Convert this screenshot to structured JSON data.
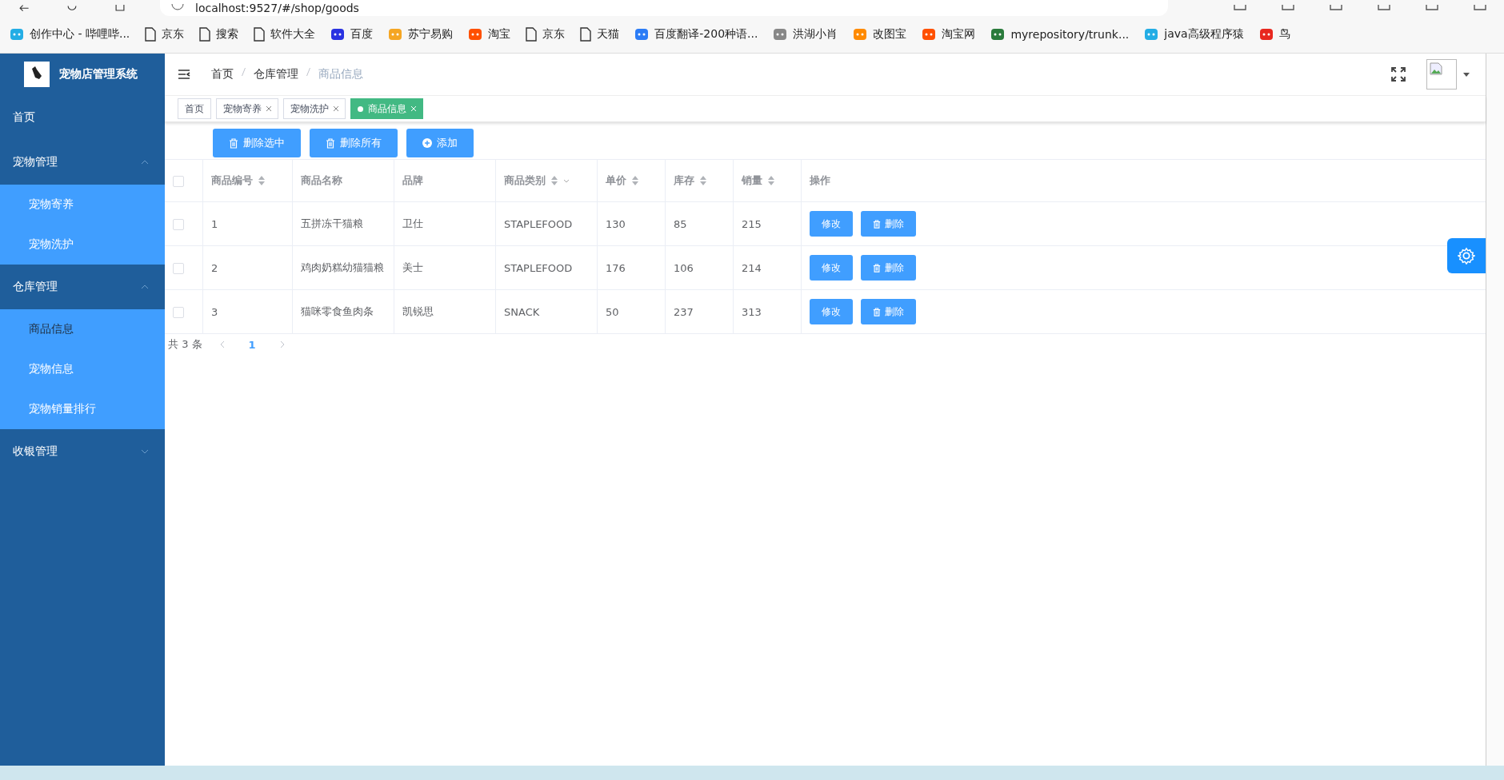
{
  "browser": {
    "address": "localhost:9527/#/shop/goods",
    "bookmarks": [
      {
        "label": "创作中心 - 哔哩哔...",
        "kind": "tv"
      },
      {
        "label": "京东",
        "kind": "page"
      },
      {
        "label": "搜索",
        "kind": "page"
      },
      {
        "label": "软件大全",
        "kind": "page"
      },
      {
        "label": "百度",
        "kind": "paw"
      },
      {
        "label": "苏宁易购",
        "kind": "lion"
      },
      {
        "label": "淘宝",
        "kind": "tao"
      },
      {
        "label": "京东",
        "kind": "page"
      },
      {
        "label": "天猫",
        "kind": "page"
      },
      {
        "label": "百度翻译-200种语...",
        "kind": "translate"
      },
      {
        "label": "洪湖小肖",
        "kind": "bird"
      },
      {
        "label": "改图宝",
        "kind": "square"
      },
      {
        "label": "淘宝网",
        "kind": "tao2"
      },
      {
        "label": "myrepository/trunk...",
        "kind": "circle"
      },
      {
        "label": "java高级程序猿",
        "kind": "tv"
      },
      {
        "label": "鸟",
        "kind": "redbird"
      }
    ]
  },
  "sidebar": {
    "title": "宠物店管理系统",
    "items": [
      {
        "label": "首页",
        "selected": false
      },
      {
        "label": "宠物管理",
        "expanded": true,
        "children": [
          {
            "label": "宠物寄养",
            "selected": false
          },
          {
            "label": "宠物洗护",
            "selected": false
          }
        ]
      },
      {
        "label": "仓库管理",
        "expanded": true,
        "children": [
          {
            "label": "商品信息",
            "selected": true
          },
          {
            "label": "宠物信息",
            "selected": false
          },
          {
            "label": "宠物销量排行",
            "selected": false
          }
        ]
      },
      {
        "label": "收银管理",
        "expanded": false
      }
    ]
  },
  "breadcrumb": [
    "首页",
    "仓库管理",
    "商品信息"
  ],
  "tabs": [
    {
      "label": "首页",
      "selected": false,
      "closable": false
    },
    {
      "label": "宠物寄养",
      "selected": false,
      "closable": true
    },
    {
      "label": "宠物洗护",
      "selected": false,
      "closable": true
    },
    {
      "label": "商品信息",
      "selected": true,
      "closable": true
    }
  ],
  "toolbar": [
    {
      "label": "删除选中",
      "kind": "trash"
    },
    {
      "label": "删除所有",
      "kind": "trash"
    },
    {
      "label": "添加",
      "kind": "plus"
    }
  ],
  "table": {
    "columns": [
      {
        "label": "商品编号",
        "sortable": true
      },
      {
        "label": "商品名称",
        "sortable": false
      },
      {
        "label": "品牌",
        "sortable": false
      },
      {
        "label": "商品类别",
        "sortable": true,
        "filter": true
      },
      {
        "label": "单价",
        "sortable": true
      },
      {
        "label": "库存",
        "sortable": true
      },
      {
        "label": "销量",
        "sortable": true
      },
      {
        "label": "操作",
        "sortable": false
      }
    ],
    "header_checked": false,
    "rows": [
      {
        "checked": false,
        "cells": [
          "1",
          "五拼冻干猫粮",
          "卫仕",
          "STAPLEFOOD",
          "130",
          "85",
          "215"
        ],
        "actions": [
          "修改",
          "删除"
        ]
      },
      {
        "checked": false,
        "cells": [
          "2",
          "鸡肉奶糕幼猫猫粮",
          "美士",
          "STAPLEFOOD",
          "176",
          "106",
          "214"
        ],
        "actions": [
          "修改",
          "删除"
        ]
      },
      {
        "checked": false,
        "cells": [
          "3",
          "猫咪零食鱼肉条",
          "凯锐思",
          "SNACK",
          "50",
          "237",
          "313"
        ],
        "actions": [
          "修改",
          "删除"
        ]
      }
    ]
  },
  "pagination": {
    "total": "共 3 条",
    "pages": [
      {
        "label": "1",
        "selected": true
      }
    ]
  }
}
